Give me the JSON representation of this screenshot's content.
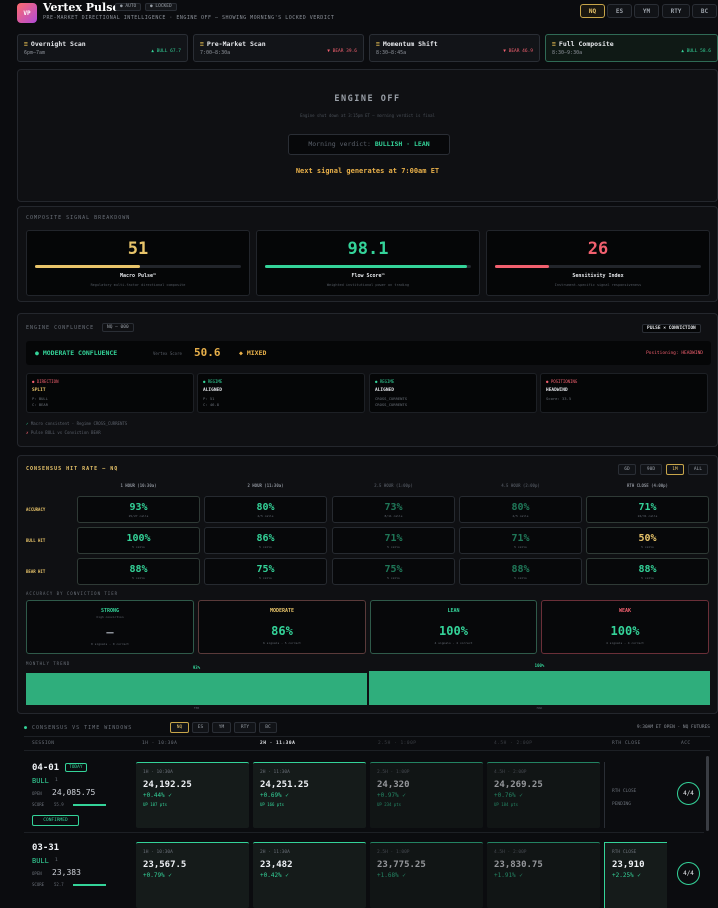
{
  "app": {
    "logo": "VP",
    "title": "Vertex Pulse",
    "auto": "AUTO",
    "locked": "LOCKED",
    "subtitle": "PRE-MARKET DIRECTIONAL INTELLIGENCE · ENGINE OFF — SHOWING MORNING'S LOCKED VERDICT",
    "tabs": [
      "NQ",
      "ES",
      "YM",
      "RTY",
      "BC"
    ],
    "active_tab": "NQ"
  },
  "scans": [
    {
      "title": "Overnight Scan",
      "time": "6pm–7am",
      "value": "▲ BULL 67.7",
      "tone": "green"
    },
    {
      "title": "Pre-Market Scan",
      "time": "7:00–8:30a",
      "value": "▼ BEAR 39.6",
      "tone": "red"
    },
    {
      "title": "Momentum Shift",
      "time": "8:30–8:45a",
      "value": "▼ BEAR 46.9",
      "tone": "red"
    },
    {
      "title": "Full Composite",
      "time": "8:30–9:30a",
      "value": "▲ BULL 58.6",
      "tone": "green"
    }
  ],
  "engine": {
    "title": "ENGINE OFF",
    "note": "Engine shut down at 3:15pm ET — morning verdict is final",
    "verdict_label": "Morning verdict:",
    "verdict": "BULLISH · LEAN",
    "next": "Next signal generates at 7:00am ET"
  },
  "breakdown": {
    "title": "COMPOSITE SIGNAL BREAKDOWN",
    "cards": [
      {
        "value": "51",
        "label": "Macro Pulse™",
        "desc": "Regulatory multi-factor directional composite",
        "fill": 0.51,
        "color": "#e8c46a"
      },
      {
        "value": "98.1",
        "label": "Flow Score™",
        "desc": "Weighted institutional power on trading",
        "fill": 0.98,
        "color": "#34d399"
      },
      {
        "value": "26",
        "label": "Sensitivity Index",
        "desc": "Instrument-specific signal responsiveness",
        "fill": 0.26,
        "color": "#f2606f"
      }
    ]
  },
  "confluence": {
    "title": "ENGINE CONFLUENCE",
    "badge": "NQ — 000",
    "right_badge": "PULSE × CONVICTION",
    "status": "MODERATE CONFLUENCE",
    "score_label": "Vertex Score",
    "score": "50.6",
    "mixed": "◆ MIXED",
    "positioning": "Positioning: HEADWIND",
    "boxes": [
      {
        "head": "● DIRECTION",
        "main": "SPLIT",
        "l1": "P: BULL",
        "l2": "C: BEAR",
        "tone": "red"
      },
      {
        "head": "● REGIME",
        "main": "ALIGNED",
        "l1": "P: 51",
        "l2": "C: 46.8",
        "tone": "green"
      },
      {
        "head": "● REGIME",
        "main": "ALIGNED",
        "l1": "CROSS_CURRENTS",
        "l2": "CROSS_CURRENTS",
        "tone": "green"
      },
      {
        "head": "● POSITIONING",
        "main": "HEADWIND",
        "l1": "Score: 33.5",
        "l2": "",
        "tone": "red"
      }
    ],
    "notes": [
      {
        "mark": "✓",
        "text": "Macro consistent · Regime CROSS_CURRENTS",
        "tone": "green"
      },
      {
        "mark": "✗",
        "text": "Pulse BULL vs Conviction BEAR",
        "tone": "red"
      }
    ]
  },
  "hitrate": {
    "title": "CONSENSUS HIT RATE — NQ",
    "ranges": [
      "6D",
      "90D",
      "1M",
      "ALL"
    ],
    "active_range": "1M",
    "columns": [
      "1 HOUR (10:30a)",
      "2 HOUR (11:30a)",
      "2.5 HOUR (1:00p)",
      "4.5 HOUR (2:00p)",
      "RTH CLOSE (4:00p)"
    ],
    "rows": [
      {
        "label": "ACCURACY",
        "cells": [
          {
            "v": "93%",
            "s": "25/27 calls"
          },
          {
            "v": "80%",
            "s": "4/5 calls"
          },
          {
            "v": "73%",
            "s": "8/11 calls"
          },
          {
            "v": "80%",
            "s": "4/5 calls"
          },
          {
            "v": "71%",
            "s": "22/31 calls"
          }
        ]
      },
      {
        "label": "BULL HIT",
        "cells": [
          {
            "v": "100%",
            "s": "5 calls"
          },
          {
            "v": "86%",
            "s": "5 calls"
          },
          {
            "v": "71%",
            "s": "5 calls"
          },
          {
            "v": "71%",
            "s": "5 calls"
          },
          {
            "v": "50%",
            "s": "5 calls"
          }
        ]
      },
      {
        "label": "BEAR HIT",
        "cells": [
          {
            "v": "88%",
            "s": "5 calls"
          },
          {
            "v": "75%",
            "s": "5 calls"
          },
          {
            "v": "75%",
            "s": "5 calls"
          },
          {
            "v": "88%",
            "s": "5 calls"
          },
          {
            "v": "88%",
            "s": "5 calls"
          }
        ]
      }
    ],
    "tier_title": "ACCURACY BY CONVICTION TIER",
    "tiers": [
      {
        "name": "STRONG",
        "sub": "high conviction",
        "value": "—",
        "calls": "0 signals · 0 correct",
        "tone": "green"
      },
      {
        "name": "MODERATE",
        "sub": "",
        "value": "86%",
        "calls": "6 signals · 5 correct",
        "tone": "amber"
      },
      {
        "name": "LEAN",
        "sub": "",
        "value": "100%",
        "calls": "4 signals · 4 correct",
        "tone": "green"
      },
      {
        "name": "WEAK",
        "sub": "",
        "value": "100%",
        "calls": "4 signals · 4 correct",
        "tone": "red"
      }
    ],
    "trend_title": "MONTHLY TREND",
    "trend": [
      {
        "label": "93%",
        "month": "FEB",
        "value": 0.93
      },
      {
        "label": "100%",
        "month": "MAR",
        "value": 1.0
      }
    ]
  },
  "consensus": {
    "title": "CONSENSUS VS TIME WINDOWS",
    "tabs": [
      "NQ",
      "ES",
      "YM",
      "RTY",
      "BC"
    ],
    "active_tab": "NQ",
    "right": "9:30AM ET OPEN · NQ FUTURES",
    "headers": [
      "SESSION",
      "1H · 10:30A",
      "2H · 11:30A",
      "2.5H · 1:00P",
      "4.5H · 2:00P",
      "RTH CLOSE",
      "ACC"
    ],
    "sessions": [
      {
        "date": "04-01",
        "today": "TODAY",
        "bias": "BULL",
        "bias_n": "1",
        "open_label": "OPEN",
        "open": "24,085.75",
        "score_label": "SCORE",
        "score": "55.9",
        "status": "CONFIRMED",
        "windows": [
          {
            "l": "1H · 10:30A",
            "p": "24,192.25",
            "c": "+0.44% ✓",
            "q": "UP 107 pts"
          },
          {
            "l": "2H · 11:30A",
            "p": "24,251.25",
            "c": "+0.69% ✓",
            "q": "UP 166 pts"
          },
          {
            "l": "2.5H · 1:00P",
            "p": "24,320",
            "c": "+0.97% ✓",
            "q": "UP 234 pts"
          },
          {
            "l": "4.5H · 2:00P",
            "p": "24,269.25",
            "c": "+0.76% ✓",
            "q": "UP 184 pts"
          }
        ],
        "rth_label": "RTH CLOSE",
        "rth": "PENDING",
        "acc": "4/4"
      },
      {
        "date": "03-31",
        "today": "",
        "bias": "BULL",
        "bias_n": "1",
        "open_label": "OPEN",
        "open": "23,383",
        "score_label": "SCORE",
        "score": "52.7",
        "status": "",
        "windows": [
          {
            "l": "1H · 10:30A",
            "p": "23,567.5",
            "c": "+0.79% ✓",
            "q": ""
          },
          {
            "l": "2H · 11:30A",
            "p": "23,482",
            "c": "+0.42% ✓",
            "q": ""
          },
          {
            "l": "2.5H · 1:00P",
            "p": "23,775.25",
            "c": "+1.68% ✓",
            "q": ""
          },
          {
            "l": "4.5H · 2:00P",
            "p": "23,830.75",
            "c": "+1.91% ✓",
            "q": ""
          }
        ],
        "rth_label": "RTH CLOSE",
        "rth": "23,910",
        "rth_change": "+2.25% ✓",
        "acc": "4/4"
      }
    ]
  }
}
